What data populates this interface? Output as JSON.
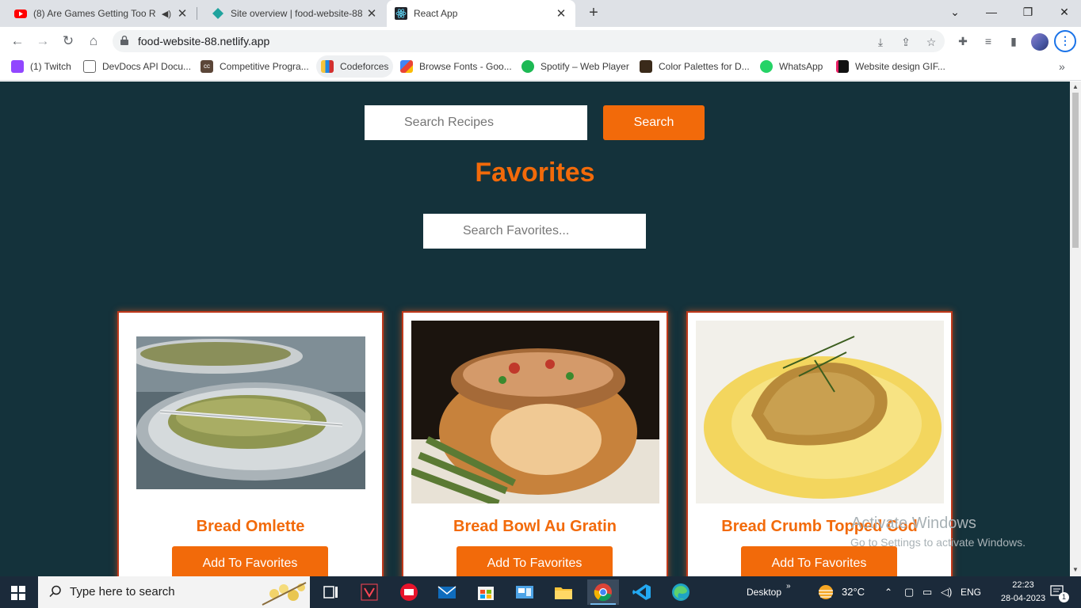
{
  "browser": {
    "tabs": [
      {
        "title": "(8) Are Games Getting Too R",
        "audio_icon": "speaker-icon",
        "icon": "youtube-icon"
      },
      {
        "title": "Site overview | food-website-88",
        "icon": "netlify-icon"
      },
      {
        "title": "React App",
        "icon": "react-icon",
        "active": true
      }
    ],
    "new_tab_label": "+",
    "url": "food-website-88.netlify.app",
    "bookmarks": [
      {
        "label": "(1) Twitch",
        "icon": "twitch-icon"
      },
      {
        "label": "DevDocs API Docu...",
        "icon": "devdocs-icon"
      },
      {
        "label": "Competitive Progra...",
        "icon": "cc-icon"
      },
      {
        "label": "Codeforces",
        "icon": "codeforces-icon"
      },
      {
        "label": "Browse Fonts - Goo...",
        "icon": "google-fonts-icon"
      },
      {
        "label": "Spotify – Web Player",
        "icon": "spotify-icon"
      },
      {
        "label": "Color Palettes for D...",
        "icon": "color-palette-icon"
      },
      {
        "label": "WhatsApp",
        "icon": "whatsapp-icon"
      },
      {
        "label": "Website design GIF...",
        "icon": "gif-icon"
      }
    ]
  },
  "app": {
    "search_placeholder": "Search Recipes",
    "search_button": "Search",
    "favorites_title": "Favorites",
    "favorites_search_placeholder": "Search Favorites...",
    "cards": [
      {
        "name": "Bread Omlette",
        "button": "Add To Favorites"
      },
      {
        "name": "Bread Bowl Au Gratin",
        "button": "Add To Favorites"
      },
      {
        "name": "Bread Crumb Topped Cod",
        "button": "Add To Favorites"
      }
    ]
  },
  "watermark": {
    "title": "Activate Windows",
    "subtitle": "Go to Settings to activate Windows."
  },
  "taskbar": {
    "search_placeholder": "Type here to search",
    "desktop_label": "Desktop",
    "weather": "32°C",
    "language": "ENG",
    "time": "22:23",
    "date": "28-04-2023",
    "notification_count": "1"
  },
  "colors": {
    "page_bg": "#14323b",
    "accent": "#f26a0a",
    "card_border": "#c0391b"
  }
}
